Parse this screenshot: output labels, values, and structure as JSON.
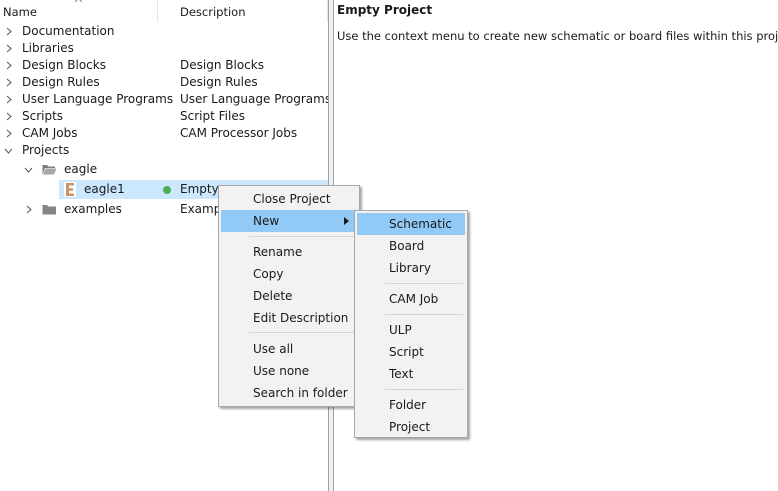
{
  "tree": {
    "headers": {
      "name": "Name",
      "description": "Description"
    },
    "rows": [
      {
        "name": "Documentation",
        "description": ""
      },
      {
        "name": "Libraries",
        "description": ""
      },
      {
        "name": "Design Blocks",
        "description": "Design Blocks"
      },
      {
        "name": "Design Rules",
        "description": "Design Rules"
      },
      {
        "name": "User Language Programs",
        "description": "User Language Programs"
      },
      {
        "name": "Scripts",
        "description": "Script Files"
      },
      {
        "name": "CAM Jobs",
        "description": "CAM Processor Jobs"
      },
      {
        "name": "Projects",
        "description": ""
      },
      {
        "name": "eagle",
        "description": ""
      },
      {
        "name": "eagle1",
        "description": "Empty"
      },
      {
        "name": "examples",
        "description": "Exampl"
      }
    ],
    "project_icon_letter": "E",
    "status_color": "#4caf50"
  },
  "detail": {
    "title": "Empty Project",
    "text": "Use the context menu to create new schematic or board files within this project."
  },
  "context_menu": {
    "close_project": "Close Project",
    "new": "New",
    "rename": "Rename",
    "copy": "Copy",
    "delete": "Delete",
    "edit_description": "Edit Description",
    "use_all": "Use all",
    "use_none": "Use none",
    "search_in_folder": "Search in folder"
  },
  "new_submenu": {
    "schematic": "Schematic",
    "board": "Board",
    "library": "Library",
    "cam_job": "CAM Job",
    "ulp": "ULP",
    "script": "Script",
    "text": "Text",
    "folder": "Folder",
    "project": "Project"
  },
  "colors": {
    "highlight": "#91c9f7",
    "selection": "#cce8ff",
    "menu_bg": "#f2f2f2"
  }
}
